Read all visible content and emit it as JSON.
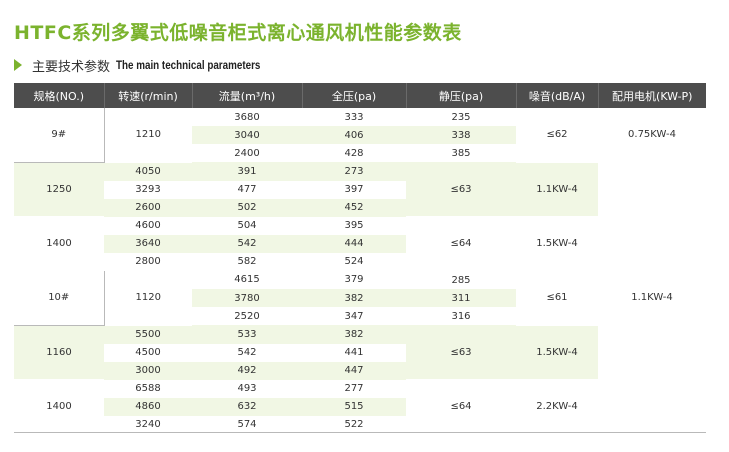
{
  "title": "HTFC系列多翼式低噪音柜式离心通风机性能参数表",
  "section": {
    "cn": "主要技术参数",
    "en": "The main technical parameters"
  },
  "headers": [
    "规格(NO.)",
    "转速(r/min)",
    "流量(m³/h)",
    "全压(pa)",
    "静压(pa)",
    "噪音(dB/A)",
    "配用电机(KW-P)"
  ],
  "colors": {
    "accent": "#7bb32e",
    "header_bg": "#4d4d4d",
    "stripe": "#f1f7e4"
  },
  "models": [
    {
      "model": "9#",
      "groups": [
        {
          "speed": "1210",
          "noise": "≤62",
          "motor": "0.75KW-4",
          "rows": [
            [
              "3680",
              "333",
              "235"
            ],
            [
              "3040",
              "406",
              "338"
            ],
            [
              "2400",
              "428",
              "385"
            ]
          ]
        },
        {
          "speed": "1250",
          "noise": "≤63",
          "motor": "1.1KW-4",
          "rows": [
            [
              "4050",
              "391",
              "273"
            ],
            [
              "3293",
              "477",
              "397"
            ],
            [
              "2600",
              "502",
              "452"
            ]
          ]
        },
        {
          "speed": "1400",
          "noise": "≤64",
          "motor": "1.5KW-4",
          "rows": [
            [
              "4600",
              "504",
              "395"
            ],
            [
              "3640",
              "542",
              "444"
            ],
            [
              "2800",
              "582",
              "524"
            ]
          ]
        }
      ]
    },
    {
      "model": "10#",
      "groups": [
        {
          "speed": "1120",
          "noise": "≤61",
          "motor": "1.1KW-4",
          "rows": [
            [
              "4615",
              "379",
              "285"
            ],
            [
              "3780",
              "382",
              "311"
            ],
            [
              "2520",
              "347",
              "316"
            ]
          ]
        },
        {
          "speed": "1160",
          "noise": "≤63",
          "motor": "1.5KW-4",
          "rows": [
            [
              "5500",
              "533",
              "382"
            ],
            [
              "4500",
              "542",
              "441"
            ],
            [
              "3000",
              "492",
              "447"
            ]
          ]
        },
        {
          "speed": "1400",
          "noise": "≤64",
          "motor": "2.2KW-4",
          "rows": [
            [
              "6588",
              "493",
              "277"
            ],
            [
              "4860",
              "632",
              "515"
            ],
            [
              "3240",
              "574",
              "522"
            ]
          ]
        }
      ]
    }
  ]
}
